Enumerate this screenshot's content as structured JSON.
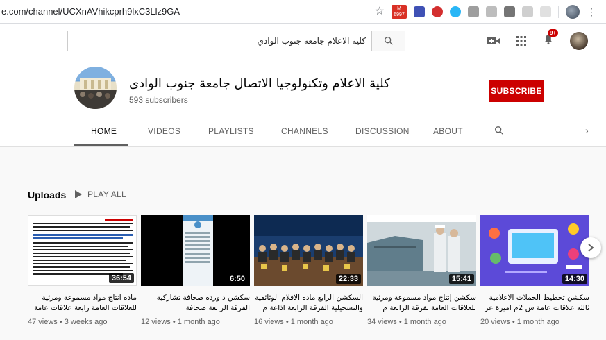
{
  "browser": {
    "url": "e.com/channel/UCXnAVhikcprh9lxC3Llz9GA",
    "gmail_count": "6997"
  },
  "header": {
    "search_value": "كلية الاعلام جامعة جنوب الوادي",
    "notification_count": "9+"
  },
  "channel": {
    "name": "كلية الاعلام وتكنولوجيا الاتصال جامعة جنوب الوادى",
    "subscribers": "593 subscribers",
    "subscribe_label": "SUBSCRIBE"
  },
  "tabs": [
    "HOME",
    "VIDEOS",
    "PLAYLISTS",
    "CHANNELS",
    "DISCUSSION",
    "ABOUT"
  ],
  "uploads": {
    "title": "Uploads",
    "play_all": "PLAY ALL"
  },
  "videos": [
    {
      "title": "مادة انتاج مواد مسموعة ومرئية للعلاقات العامة رابعة علاقات عامة م حسن النوبى",
      "duration": "36:54",
      "meta": "47 views • 3 weeks ago"
    },
    {
      "title": "سكشن د وردة صحافة تشاركية الفرقة الرابعة صحافة",
      "duration": "6:50",
      "meta": "12 views • 1 month ago"
    },
    {
      "title": "السكشن الرابع مادة الافلام الوثائقية والتسجيلية الفرقة الرابعة اذاعة م وليد...",
      "duration": "22:33",
      "meta": "16 views • 1 month ago"
    },
    {
      "title": "سكشن إنتاج مواد مسموعة ومرئية للعلاقات العامةالفرقة الرابعة م حسن...",
      "duration": "15:41",
      "meta": "34 views • 1 month ago"
    },
    {
      "title": "سكشن تخطيط الحملات الاعلامية ثالثه علاقات عامة س 2م اميرة عز",
      "duration": "14:30",
      "meta": "20 views • 1 month ago"
    }
  ],
  "colors": {
    "brand_red": "#cc0000",
    "background": "#f9f9f9"
  }
}
